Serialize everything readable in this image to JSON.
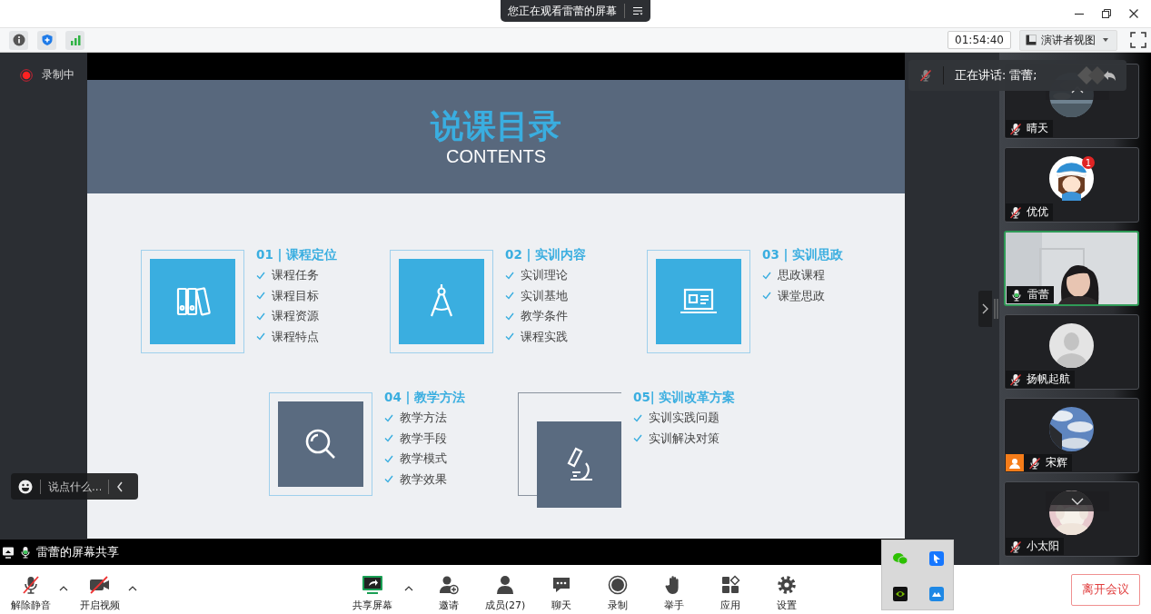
{
  "window": {
    "banner": "您正在观看雷蕾的屏幕",
    "timer": "01:54:40",
    "view_mode": "演讲者视图"
  },
  "recording": {
    "label": "录制中"
  },
  "slide": {
    "title": "说课目录",
    "subtitle": "CONTENTS",
    "sections": [
      {
        "title": "01 | 课程定位",
        "kind": "framed",
        "color": "#3aaee0",
        "points": [
          "课程任务",
          "课程目标",
          "课程资源",
          "课程特点"
        ]
      },
      {
        "title": "02 | 实训内容",
        "kind": "framed",
        "color": "#3aaee0",
        "points": [
          "实训理论",
          "实训基地",
          "教学条件",
          "课程实践"
        ]
      },
      {
        "title": "03 | 实训思政",
        "kind": "framed",
        "color": "#3aaee0",
        "points": [
          "思政课程",
          "课堂思政"
        ]
      },
      {
        "title": "04 | 教学方法",
        "kind": "framed",
        "color": "#5a6b80",
        "points": [
          "教学方法",
          "教学手段",
          "教学模式",
          "教学效果"
        ]
      },
      {
        "title": "05| 实训改革方案",
        "kind": "offset",
        "color": "#5a6b80",
        "points": [
          "实训实践问题",
          "实训解决对策"
        ]
      }
    ]
  },
  "chat": {
    "placeholder": "说点什么..."
  },
  "share_label": "雷蕾的屏幕共享",
  "speaker": {
    "label": "正在讲话: 雷蕾;"
  },
  "participants": [
    {
      "name": "晴天",
      "muted": true,
      "active": false,
      "host": false
    },
    {
      "name": "优优",
      "muted": true,
      "kind": "cartoon",
      "active": false,
      "host": false,
      "badge": "1"
    },
    {
      "name": "雷蕾",
      "muted": false,
      "kind": "video",
      "active": true,
      "host": false
    },
    {
      "name": "扬帆起航",
      "muted": true,
      "kind": "silhouette",
      "active": false,
      "host": false
    },
    {
      "name": "宋辉",
      "muted": true,
      "active": false,
      "host": true
    },
    {
      "name": "小太阳",
      "muted": true,
      "active": false,
      "host": false
    }
  ],
  "toolbar": [
    {
      "label": "解除静音",
      "kind": "mic",
      "menu": true
    },
    {
      "label": "开启视频",
      "kind": "video",
      "menu": true
    },
    {
      "label": "共享屏幕",
      "kind": "share",
      "menu": true
    },
    {
      "label": "邀请",
      "kind": "invite",
      "menu": false
    },
    {
      "label": "成员(27)",
      "kind": "members",
      "menu": false
    },
    {
      "label": "聊天",
      "kind": "chat",
      "menu": false
    },
    {
      "label": "录制",
      "kind": "record",
      "menu": false
    },
    {
      "label": "举手",
      "kind": "hand",
      "menu": false
    },
    {
      "label": "应用",
      "kind": "apps",
      "menu": false
    },
    {
      "label": "设置",
      "kind": "settings",
      "menu": false
    }
  ],
  "leave_button": "离开会议"
}
